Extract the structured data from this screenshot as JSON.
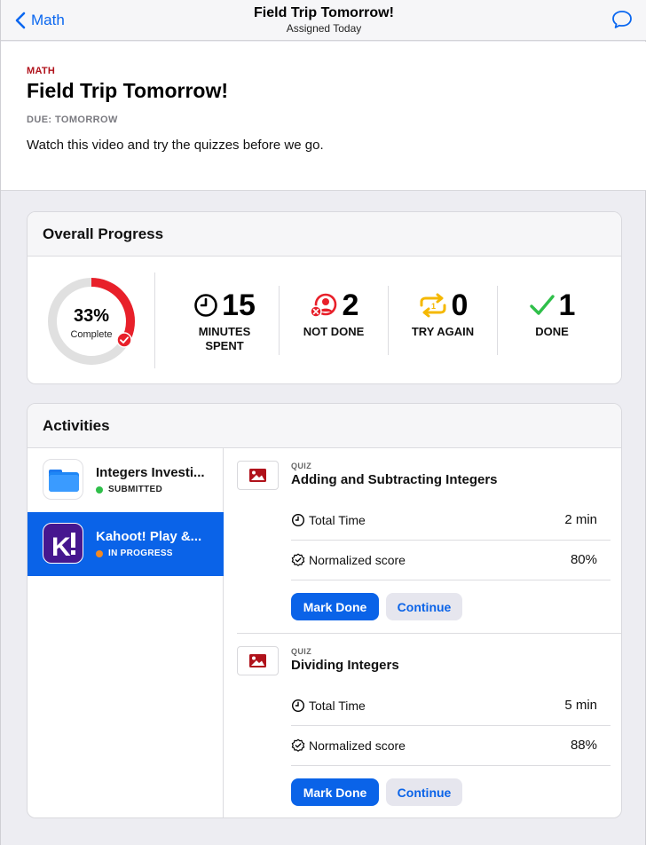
{
  "nav": {
    "back_label": "Math",
    "title": "Field Trip Tomorrow!",
    "subtitle": "Assigned Today"
  },
  "assignment": {
    "subject": "MATH",
    "title": "Field Trip Tomorrow!",
    "due": "DUE: TOMORROW",
    "description": "Watch this video and try the quizzes before we go."
  },
  "progress": {
    "heading": "Overall Progress",
    "percent_text": "33%",
    "percent_value": 0.33,
    "complete_label": "Complete",
    "stats": [
      {
        "icon": "clock-icon",
        "value": "15",
        "label_line1": "MINUTES",
        "label_line2": "SPENT"
      },
      {
        "icon": "not-done-icon",
        "value": "2",
        "label_line1": "NOT DONE",
        "label_line2": ""
      },
      {
        "icon": "try-again-icon",
        "value": "0",
        "label_line1": "TRY AGAIN",
        "label_line2": ""
      },
      {
        "icon": "checkmark-icon",
        "value": "1",
        "label_line1": "DONE",
        "label_line2": ""
      }
    ]
  },
  "activities": {
    "heading": "Activities",
    "items": [
      {
        "title": "Integers Investi...",
        "status": "SUBMITTED",
        "status_color": "#2fbf4a",
        "icon": "files-app-icon"
      },
      {
        "title": "Kahoot! Play &...",
        "status": "IN PROGRESS",
        "status_color": "#f5891f",
        "icon": "kahoot-icon"
      }
    ],
    "quizzes": [
      {
        "kind": "QUIZ",
        "title": "Adding and Subtracting Integers",
        "time_label": "Total Time",
        "time_value": "2 min",
        "score_label": "Normalized score",
        "score_value": "80%",
        "mark_done": "Mark Done",
        "continue": "Continue"
      },
      {
        "kind": "QUIZ",
        "title": "Dividing Integers",
        "time_label": "Total Time",
        "time_value": "5 min",
        "score_label": "Normalized score",
        "score_value": "88%",
        "mark_done": "Mark Done",
        "continue": "Continue"
      }
    ]
  },
  "colors": {
    "accent": "#0a63e8",
    "ring_progress": "#e8202a",
    "ring_track": "#e0e0e0",
    "subject": "#b0121b",
    "try_again": "#f5b800",
    "done_check": "#2fbf4a"
  }
}
